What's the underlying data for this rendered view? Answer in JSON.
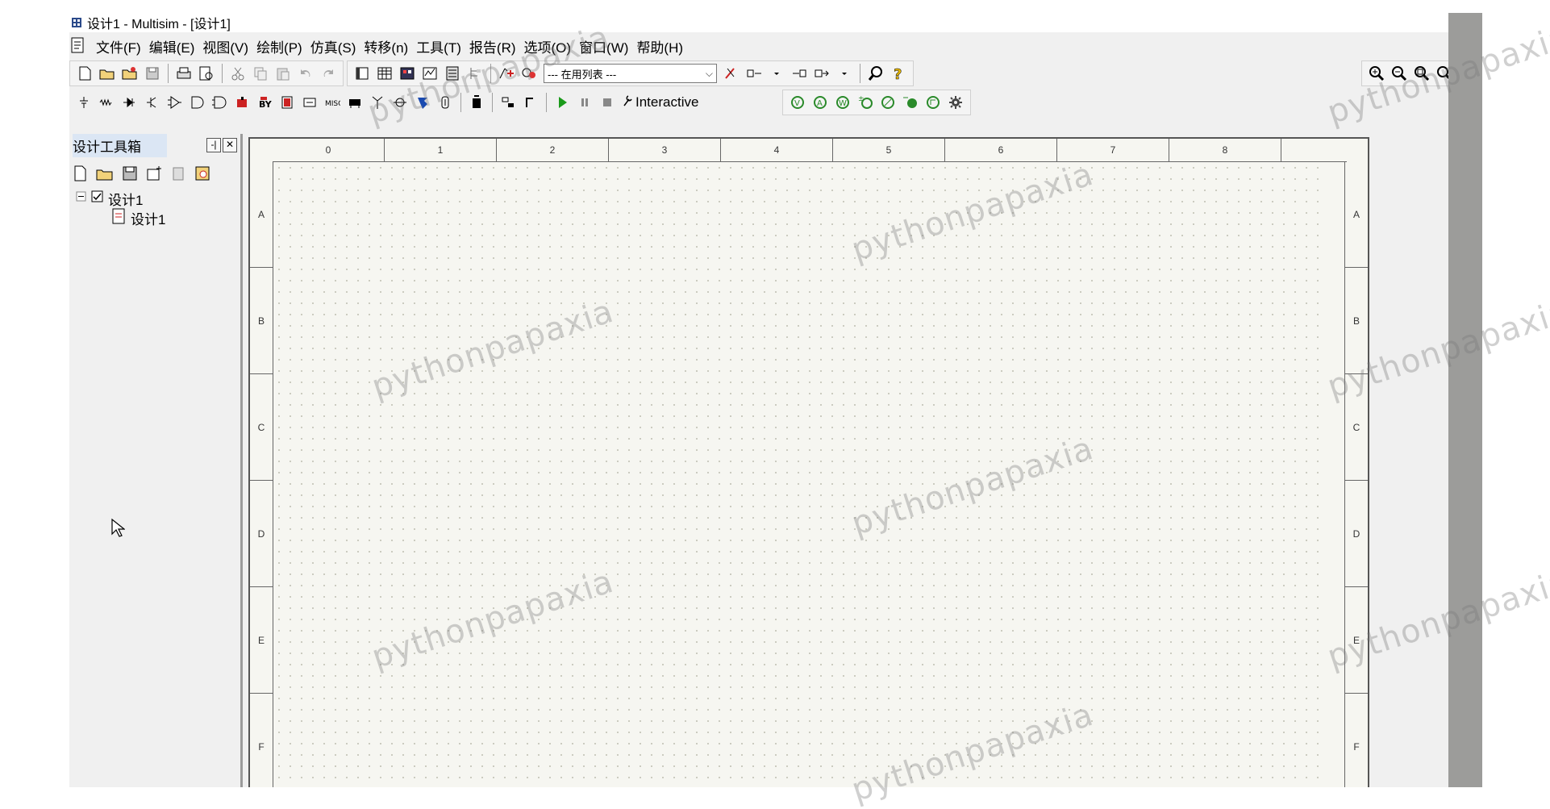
{
  "window": {
    "title": "设计1 - Multisim - [设计1]"
  },
  "menu": [
    {
      "label": "文件(F)"
    },
    {
      "label": "编辑(E)"
    },
    {
      "label": "视图(V)"
    },
    {
      "label": "绘制(P)"
    },
    {
      "label": "仿真(S)"
    },
    {
      "label": "转移(n)"
    },
    {
      "label": "工具(T)"
    },
    {
      "label": "报告(R)"
    },
    {
      "label": "选项(O)"
    },
    {
      "label": "窗口(W)"
    },
    {
      "label": "帮助(H)"
    }
  ],
  "toolbar": {
    "inuse_combo": "--- 在用列表 ---",
    "interactive_label": "Interactive"
  },
  "design_toolbox": {
    "title": "设计工具箱",
    "tree": {
      "root": "设计1",
      "child": "设计1"
    }
  },
  "sheet": {
    "columns": [
      "0",
      "1",
      "2",
      "3",
      "4",
      "5",
      "6",
      "7",
      "8",
      ""
    ],
    "rows": [
      "A",
      "B",
      "C",
      "D",
      "E",
      "F"
    ]
  },
  "watermark_text": "pythonpapaxia",
  "colors": {
    "sheet_bg": "#f6f6f1",
    "play_green": "#1a9a1a",
    "probe_green": "#2a8a2a"
  }
}
